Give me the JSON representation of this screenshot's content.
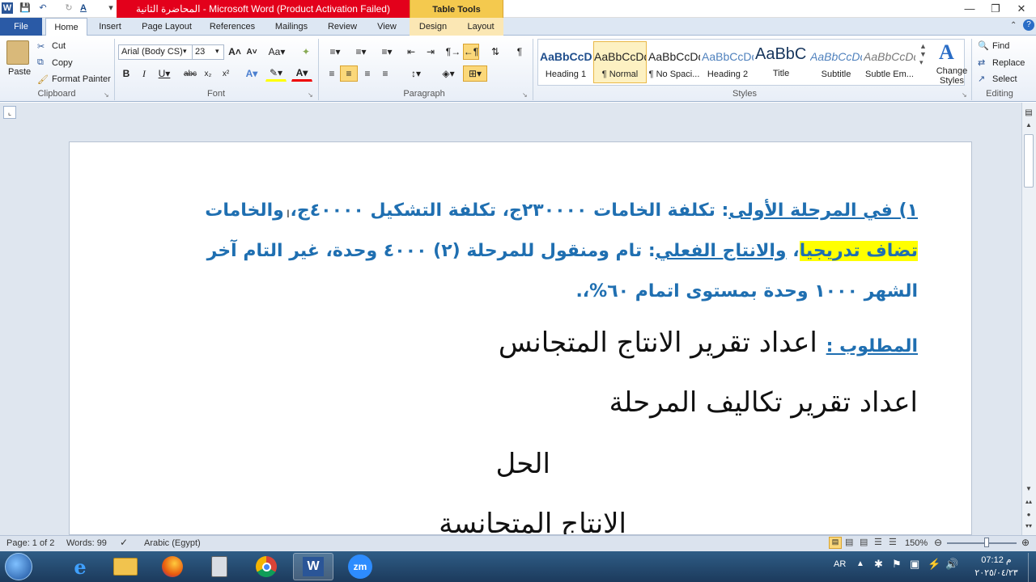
{
  "window": {
    "title": "المحاضرة الثانية  -  Microsoft Word (Product Activation Failed)",
    "contextual_group": "Table Tools"
  },
  "tabs": [
    "Home",
    "Insert",
    "Page Layout",
    "References",
    "Mailings",
    "Review",
    "View",
    "Design",
    "Layout"
  ],
  "file_tab": "File",
  "clipboard": {
    "paste": "Paste",
    "cut": "Cut",
    "copy": "Copy",
    "format_painter": "Format Painter",
    "label": "Clipboard"
  },
  "font": {
    "name": "Arial (Body CS)",
    "size": "23",
    "label": "Font"
  },
  "paragraph": {
    "label": "Paragraph"
  },
  "styles": {
    "label": "Styles",
    "items": [
      {
        "sample": "AaBbCcDdEe",
        "name": "Heading 1"
      },
      {
        "sample": "AaBbCcDdEe",
        "name": "¶ Normal"
      },
      {
        "sample": "AaBbCcDdEe",
        "name": "¶ No Spaci..."
      },
      {
        "sample": "AaBbCcDdEe",
        "name": "Heading 2"
      },
      {
        "sample": "AaBbCcDdEe",
        "name": "Title"
      },
      {
        "sample": "AaBbCcDdEe",
        "name": "Subtitle"
      },
      {
        "sample": "AaBbCcDdEe",
        "name": "Subtle Em..."
      }
    ],
    "change_styles": "Change Styles"
  },
  "editing": {
    "find": "Find",
    "replace": "Replace",
    "select": "Select",
    "label": "Editing"
  },
  "document": {
    "line1_a": "١) في المرحلة الأولى",
    "line1_b": ": تكلفة الخامات ٢٣٠٠٠٠ج، تكلفة التشكيل ٤٠٠٠٠ج، والخامات",
    "line2_a": "تضاف تدريجيا",
    "line2_b": "، ",
    "line2_c": "والانتاج الفعلي",
    "line2_d": ": تام ومنقول للمرحلة (٢) ٤٠٠٠ وحدة، غير التام آخر",
    "line3": "الشهر ١٠٠٠ وحدة بمستوى اتمام ٦٠%،.",
    "line4_a": "المطلوب :",
    "line4_b": " اعداد تقرير الانتاج المتجانس",
    "line5": "اعداد تقرير تكاليف المرحلة",
    "line6": "الحل",
    "line7": "الانتاج المتجانسة"
  },
  "status": {
    "page": "Page: 1 of 2",
    "words": "Words: 99",
    "language": "Arabic (Egypt)",
    "zoom": "150%"
  },
  "tray": {
    "lang": "AR",
    "time": "07:12 م",
    "date": "٢٠٢٥/٠٤/٢٣"
  }
}
